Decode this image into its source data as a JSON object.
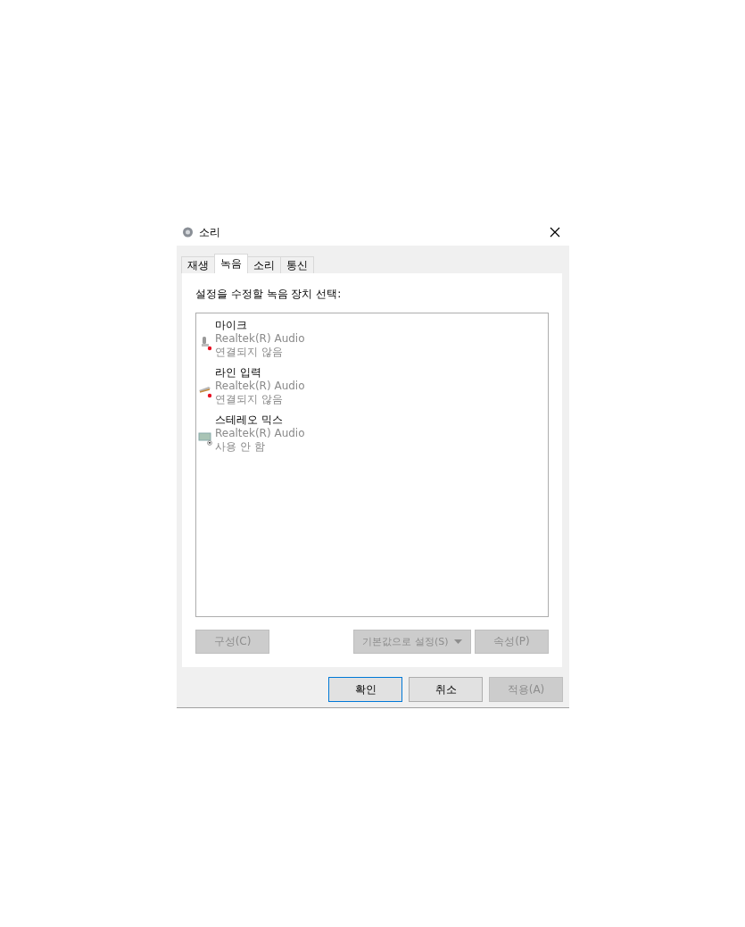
{
  "window": {
    "title": "소리"
  },
  "tabs": [
    {
      "label": "재생",
      "selected": false
    },
    {
      "label": "녹음",
      "selected": true
    },
    {
      "label": "소리",
      "selected": false
    },
    {
      "label": "통신",
      "selected": false
    }
  ],
  "instruction": "설정을 수정할 녹음 장치 선택:",
  "devices": [
    {
      "kind": "microphone",
      "name": "마이크",
      "driver": "Realtek(R) Audio",
      "status": "연결되지 않음",
      "unplugged": true,
      "disabled": false
    },
    {
      "kind": "line",
      "name": "라인 입력",
      "driver": "Realtek(R) Audio",
      "status": "연결되지 않음",
      "unplugged": true,
      "disabled": false
    },
    {
      "kind": "stereo",
      "name": "스테레오 믹스",
      "driver": "Realtek(R) Audio",
      "status": "사용 안 함",
      "unplugged": false,
      "disabled": true
    }
  ],
  "panel_buttons": [
    {
      "label": "구성(C)",
      "disabled": true
    },
    {
      "label": "기본값으로 설정(S)",
      "disabled": true,
      "dropdown": true
    },
    {
      "label": "속성(P)",
      "disabled": true
    }
  ],
  "dialog_buttons": [
    {
      "label": "확인",
      "disabled": false,
      "default": true
    },
    {
      "label": "취소",
      "disabled": false,
      "default": false
    },
    {
      "label": "적용(A)",
      "disabled": true,
      "default": false
    }
  ]
}
